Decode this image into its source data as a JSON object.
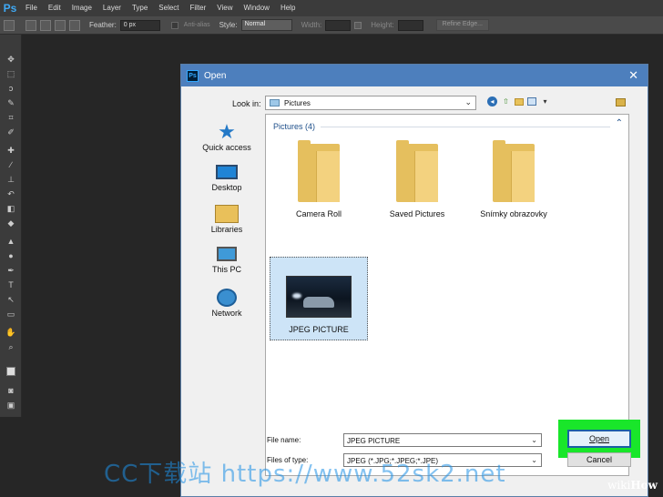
{
  "app": {
    "logo": "Ps",
    "menu": [
      "File",
      "Edit",
      "Image",
      "Layer",
      "Type",
      "Select",
      "Filter",
      "View",
      "Window",
      "Help"
    ]
  },
  "options": {
    "feather_label": "Feather:",
    "feather_value": "0 px",
    "antialias_label": "Anti-alias",
    "style_label": "Style:",
    "style_value": "Normal",
    "width_label": "Width:",
    "height_label": "Height:",
    "refine_button": "Refine Edge..."
  },
  "dialog": {
    "title": "Open",
    "close_glyph": "✕",
    "look_in_label": "Look in:",
    "look_in_value": "Pictures",
    "places": [
      {
        "label": "Quick access",
        "icon": "star-icon"
      },
      {
        "label": "Desktop",
        "icon": "desktop-icon"
      },
      {
        "label": "Libraries",
        "icon": "libraries-icon"
      },
      {
        "label": "This PC",
        "icon": "computer-icon"
      },
      {
        "label": "Network",
        "icon": "network-icon"
      }
    ],
    "group_header": "Pictures (4)",
    "items": [
      {
        "label": "Camera Roll",
        "type": "folder"
      },
      {
        "label": "Saved Pictures",
        "type": "folder"
      },
      {
        "label": "Snímky obrazovky",
        "type": "folder"
      },
      {
        "label": "JPEG PICTURE",
        "type": "image",
        "selected": true
      }
    ],
    "file_name_label": "File name:",
    "file_name_value": "JPEG PICTURE",
    "file_type_label": "Files of type:",
    "file_type_value": "JPEG (*.JPG;*.JPEG;*.JPE)",
    "open_button": "Open",
    "cancel_button": "Cancel"
  },
  "colors": {
    "highlight": "#19e62a",
    "titlebar": "#4d7fbd"
  },
  "watermark": "CC下载站 https://www.52sk2.net",
  "brand": {
    "wiki": "wiki",
    "how": "How"
  }
}
